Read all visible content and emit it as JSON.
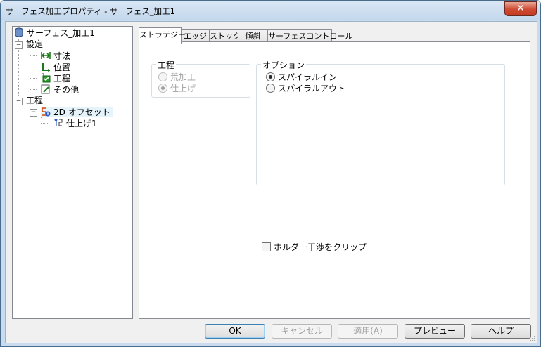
{
  "window": {
    "title": "サーフェス加工プロパティ - サーフェス_加工1",
    "close_glyph": "✕"
  },
  "tree": {
    "root": "サーフェス_加工1",
    "settings": "設定",
    "settings_children": [
      "寸法",
      "位置",
      "工程",
      "その他"
    ],
    "process": "工程",
    "offset": "2D オフセット",
    "finish": "仕上げ1"
  },
  "tabs": [
    "ストラテジー",
    "エッジ",
    "ストック",
    "傾斜",
    "サーフェスコントロール"
  ],
  "process_group": {
    "title": "工程",
    "options": [
      {
        "label": "荒加工",
        "checked": false,
        "enabled": false
      },
      {
        "label": "仕上げ",
        "checked": true,
        "enabled": false
      }
    ]
  },
  "option_group": {
    "title": "オプション",
    "options": [
      {
        "label": "スパイラルイン",
        "checked": true,
        "enabled": true
      },
      {
        "label": "スパイラルアウト",
        "checked": false,
        "enabled": true
      }
    ]
  },
  "clip_checkbox": {
    "label": "ホルダー干渉をクリップ",
    "checked": false
  },
  "buttons": {
    "ok": "OK",
    "cancel": "キャンセル",
    "apply": "適用(A)",
    "preview": "プレビュー",
    "help": "ヘルプ"
  }
}
